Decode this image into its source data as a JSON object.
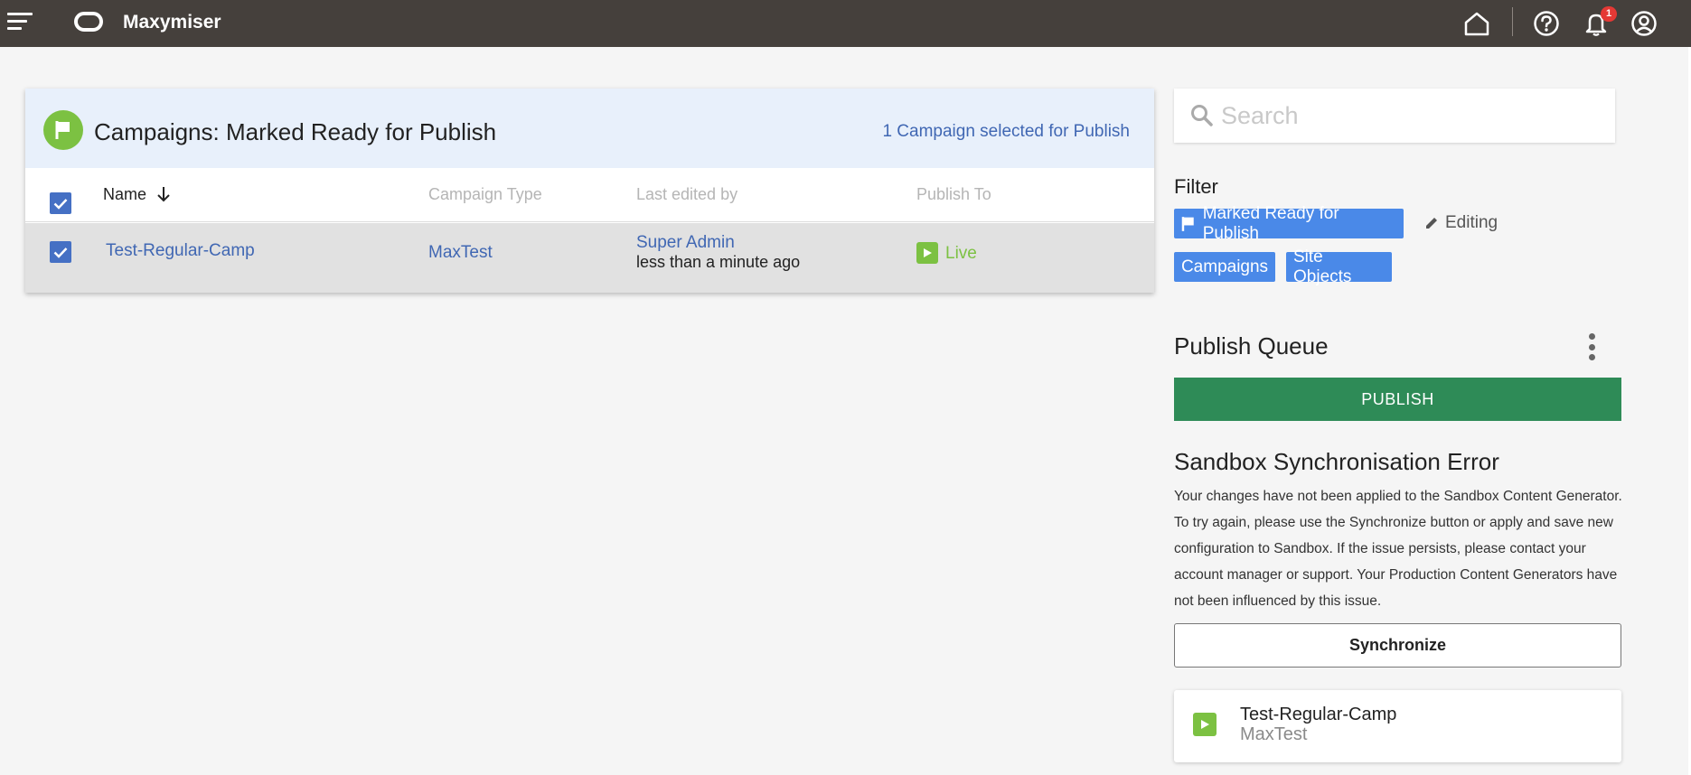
{
  "app": {
    "title": "Maxymiser",
    "notification_count": "1"
  },
  "campaigns": {
    "title": "Campaigns: Marked Ready for Publish",
    "selected_text": "1 Campaign selected for Publish",
    "columns": {
      "name": "Name",
      "type": "Campaign Type",
      "edited": "Last edited by",
      "publish_to": "Publish To"
    },
    "rows": [
      {
        "name": "Test-Regular-Camp",
        "type": "MaxTest",
        "editor": "Super Admin",
        "edited_when": "less than a minute ago",
        "publish_to": "Live",
        "checked": true
      }
    ]
  },
  "search": {
    "placeholder": "Search"
  },
  "filter": {
    "label": "Filter",
    "chips": {
      "ready": "Marked Ready for Publish",
      "campaigns": "Campaigns",
      "site_objects": "Site Objects"
    },
    "editing": "Editing"
  },
  "publish_queue": {
    "title": "Publish Queue",
    "publish_label": "PUBLISH",
    "items": [
      {
        "name": "Test-Regular-Camp",
        "type": "MaxTest"
      }
    ]
  },
  "sync_error": {
    "title": "Sandbox Synchronisation Error",
    "message": "Your changes have not been applied to the Sandbox Content Generator. To try again, please use the Synchronize button or apply and save new configuration to Sandbox. If the issue persists, please contact your account manager or support. Your Production Content Generators have not been influenced by this issue.",
    "button_label": "Synchronize"
  },
  "colors": {
    "topbar": "#45403c",
    "accent": "#4067b3",
    "live": "#7cc142",
    "publish": "#2e8b57",
    "chip": "#4a89e8"
  }
}
